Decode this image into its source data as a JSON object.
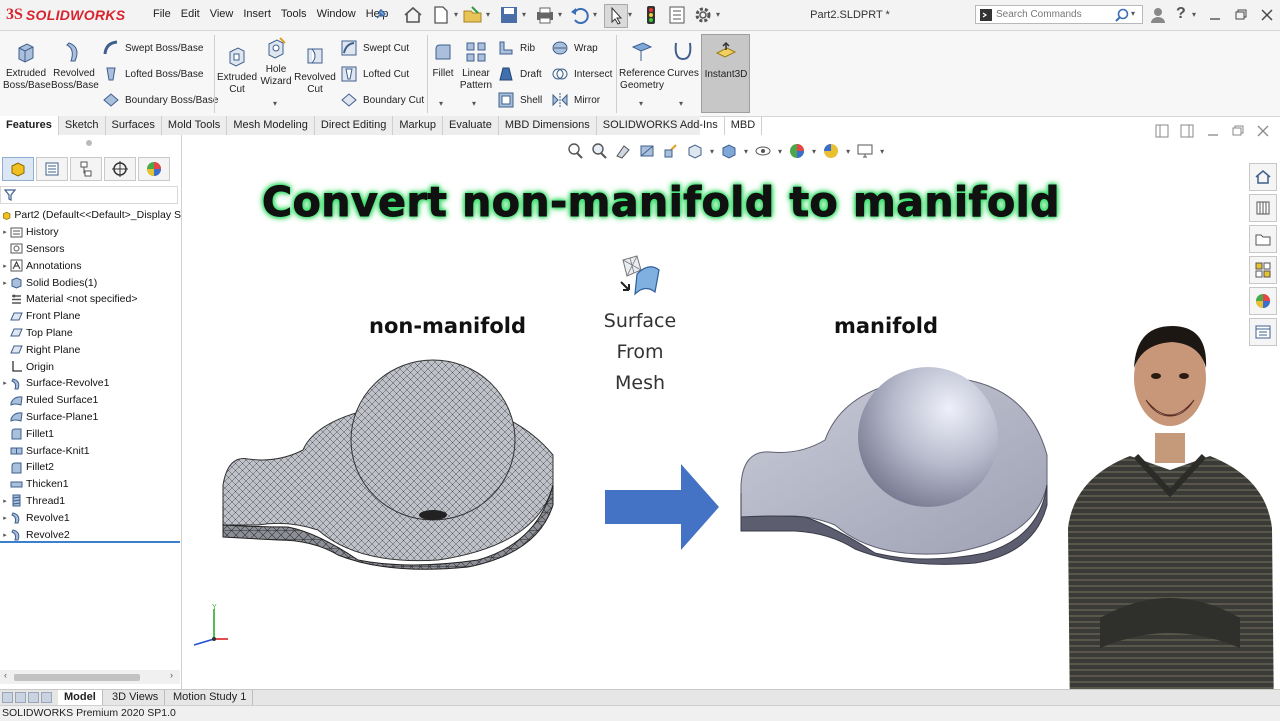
{
  "app": {
    "brand_ds": "3S",
    "brand_name": "SOLIDWORKS",
    "doc_title": "Part2.SLDPRT *"
  },
  "menus": [
    "File",
    "Edit",
    "View",
    "Insert",
    "Tools",
    "Window",
    "Help"
  ],
  "search": {
    "placeholder": "Search Commands"
  },
  "ribbon": {
    "extruded_boss": "Extruded Boss/Base",
    "revolved_boss": "Revolved Boss/Base",
    "swept_boss": "Swept Boss/Base",
    "lofted_boss": "Lofted Boss/Base",
    "boundary_boss": "Boundary Boss/Base",
    "extruded_cut": "Extruded Cut",
    "hole_wizard": "Hole Wizard",
    "revolved_cut": "Revolved Cut",
    "swept_cut": "Swept Cut",
    "lofted_cut": "Lofted Cut",
    "boundary_cut": "Boundary Cut",
    "fillet": "Fillet",
    "linear_pattern": "Linear Pattern",
    "rib": "Rib",
    "draft": "Draft",
    "shell": "Shell",
    "wrap": "Wrap",
    "intersect": "Intersect",
    "mirror": "Mirror",
    "reference_geometry": "Reference Geometry",
    "curves": "Curves",
    "instant3d": "Instant3D"
  },
  "tabs": [
    "Features",
    "Sketch",
    "Surfaces",
    "Mold Tools",
    "Mesh Modeling",
    "Direct Editing",
    "Markup",
    "Evaluate",
    "MBD Dimensions",
    "SOLIDWORKS Add-Ins",
    "MBD"
  ],
  "tree": {
    "root": "Part2  (Default<<Default>_Display S",
    "items": [
      {
        "label": "History",
        "icon": "history-icon",
        "expand": true
      },
      {
        "label": "Sensors",
        "icon": "sensor-icon",
        "expand": false
      },
      {
        "label": "Annotations",
        "icon": "annotation-icon",
        "expand": true
      },
      {
        "label": "Solid Bodies(1)",
        "icon": "solid-bodies-icon",
        "expand": true
      },
      {
        "label": "Material <not specified>",
        "icon": "material-icon",
        "expand": false
      },
      {
        "label": "Front Plane",
        "icon": "plane-icon",
        "expand": false
      },
      {
        "label": "Top Plane",
        "icon": "plane-icon",
        "expand": false
      },
      {
        "label": "Right Plane",
        "icon": "plane-icon",
        "expand": false
      },
      {
        "label": "Origin",
        "icon": "origin-icon",
        "expand": false
      },
      {
        "label": "Surface-Revolve1",
        "icon": "revolve-icon",
        "expand": true
      },
      {
        "label": "Ruled Surface1",
        "icon": "surface-icon",
        "expand": false
      },
      {
        "label": "Surface-Plane1",
        "icon": "surface-icon",
        "expand": false
      },
      {
        "label": "Fillet1",
        "icon": "fillet-icon",
        "expand": false
      },
      {
        "label": "Surface-Knit1",
        "icon": "knit-icon",
        "expand": false
      },
      {
        "label": "Fillet2",
        "icon": "fillet-icon",
        "expand": false
      },
      {
        "label": "Thicken1",
        "icon": "thicken-icon",
        "expand": false
      },
      {
        "label": "Thread1",
        "icon": "thread-icon",
        "expand": true
      },
      {
        "label": "Revolve1",
        "icon": "revolve-icon",
        "expand": true
      },
      {
        "label": "Revolve2",
        "icon": "revolve-icon",
        "expand": true
      }
    ]
  },
  "bottom_tabs": [
    "Model",
    "3D Views",
    "Motion Study 1"
  ],
  "status": "SOLIDWORKS Premium 2020 SP1.0",
  "graphics": {
    "headline": "Convert non-manifold  to manifold",
    "left_caption": "non-manifold",
    "right_caption": "manifold",
    "command_label_lines": [
      "Surface",
      "From",
      "Mesh"
    ],
    "axis_y": "Y"
  },
  "colors": {
    "brand": "#d9232e",
    "arrow": "#4472c4",
    "headline_glow": "#2ee86a",
    "tree_accent": "#3a7fd0"
  }
}
